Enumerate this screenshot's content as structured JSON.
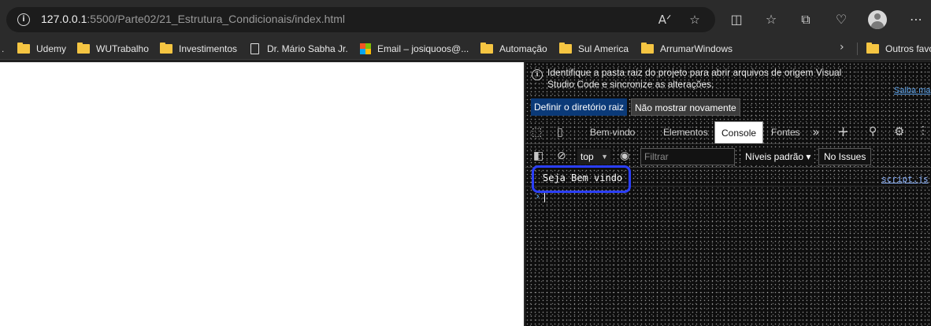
{
  "browser": {
    "url_host": "127.0.0.1",
    "url_path": ":5500/Parte02/21_Estrutura_Condicionais/index.html",
    "icons": [
      "info-icon",
      "read-aloud-icon",
      "favorite-star-icon",
      "split-screen-icon",
      "favorites-list-icon",
      "collections-icon",
      "browser-essentials-icon",
      "profile-avatar",
      "more-icon"
    ]
  },
  "bookmarks": {
    "items": [
      {
        "label": "Udemy",
        "icon": "folder-icon"
      },
      {
        "label": "WUTrabalho",
        "icon": "folder-icon"
      },
      {
        "label": "Investimentos",
        "icon": "folder-icon"
      },
      {
        "label": "Dr. Mário Sabha Jr.",
        "icon": "page-icon"
      },
      {
        "label": "Email – josiquoos@...",
        "icon": "outlook-icon"
      },
      {
        "label": "Automação",
        "icon": "folder-icon"
      },
      {
        "label": "Sul America",
        "icon": "folder-icon"
      },
      {
        "label": "ArrumarWindows",
        "icon": "folder-icon"
      }
    ],
    "overflow": "Outros favo"
  },
  "devtools": {
    "notice": {
      "text": "Identifique a pasta raiz do projeto para abrir arquivos de origem Visual Studio Code e sincronize as alterações.",
      "learn_more": "Saiba ma",
      "primary_button": "Definir o diretório raiz",
      "secondary_button": "Não mostrar novamente"
    },
    "tabs": [
      {
        "label": "Bem-vindo",
        "active": false
      },
      {
        "label": "Elementos",
        "active": false
      },
      {
        "label": "Console",
        "active": true
      },
      {
        "label": "Fontes",
        "active": false
      }
    ],
    "console_toolbar": {
      "context": "top",
      "filter_placeholder": "Filtrar",
      "levels": "Níveis padrão",
      "issues": "No Issues"
    },
    "log": {
      "message": "Seja Bem vindo",
      "source": "script.js"
    },
    "prompt": "›"
  },
  "colors": {
    "highlight_border": "#2b3fff",
    "primary_button": "#0b3a78",
    "link": "#5aa0e8"
  }
}
